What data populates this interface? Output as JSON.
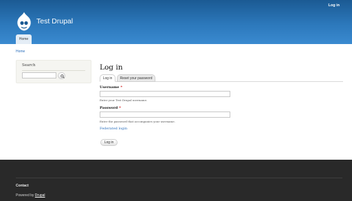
{
  "header": {
    "site_name": "Test Drupal",
    "login_link": "Log in",
    "nav": [
      {
        "label": "Home"
      }
    ]
  },
  "breadcrumb": "Home",
  "sidebar": {
    "search_block": {
      "title": "Search",
      "input_value": "",
      "button_icon": "search-icon"
    }
  },
  "main": {
    "title": "Log in",
    "tabs": [
      {
        "label": "Log in",
        "active": true
      },
      {
        "label": "Reset your password",
        "active": false
      }
    ],
    "username": {
      "label": "Username",
      "required_marker": "*",
      "value": "",
      "description": "Enter your Test Drupal username."
    },
    "password": {
      "label": "Password",
      "required_marker": "*",
      "value": "",
      "description": "Enter the password that accompanies your username."
    },
    "federated_login": "Federated login",
    "submit_label": "Log in"
  },
  "footer": {
    "contact": "Contact",
    "powered_by": "Powered by",
    "drupal_link": "Drupal"
  },
  "colors": {
    "header_blue": "#2c78bb",
    "link_blue": "#2a6ebb",
    "footer_dark": "#292929",
    "required_red": "#cc0000"
  }
}
